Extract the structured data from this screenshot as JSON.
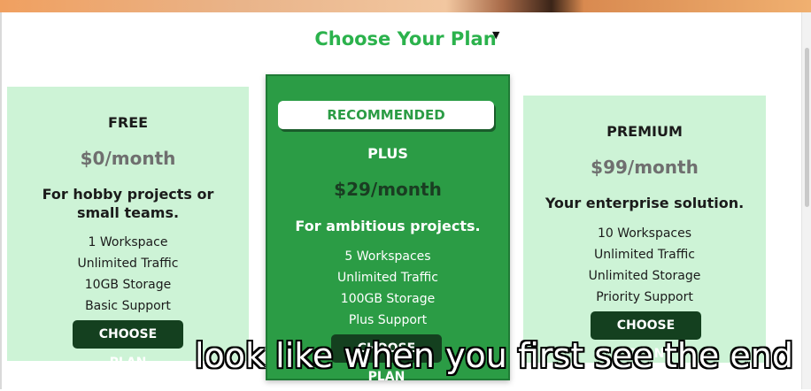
{
  "page": {
    "title": "Choose Your Plan"
  },
  "plans": [
    {
      "name": "FREE",
      "price": "$0/month",
      "description": "For hobby projects or small teams.",
      "features": [
        "1 Workspace",
        "Unlimited Traffic",
        "10GB Storage",
        "Basic Support"
      ],
      "button_label": "CHOOSE PLAN"
    },
    {
      "badge": "RECOMMENDED",
      "name": "PLUS",
      "price": "$29/month",
      "description": "For ambitious projects.",
      "features": [
        "5 Workspaces",
        "Unlimited Traffic",
        "100GB Storage",
        "Plus Support"
      ],
      "button_label": "CHOOSE PLAN"
    },
    {
      "name": "PREMIUM",
      "price": "$99/month",
      "description": "Your enterprise solution.",
      "features": [
        "10 Workspaces",
        "Unlimited Traffic",
        "Unlimited Storage",
        "Priority Support"
      ],
      "button_label": "CHOOSE PLAN"
    }
  ],
  "caption": "look like when you first see the end",
  "colors": {
    "accent": "#2bb24c",
    "card_bg": "#cdf3d6",
    "highlight_bg": "#2b9c45",
    "button_bg": "#14401f"
  }
}
